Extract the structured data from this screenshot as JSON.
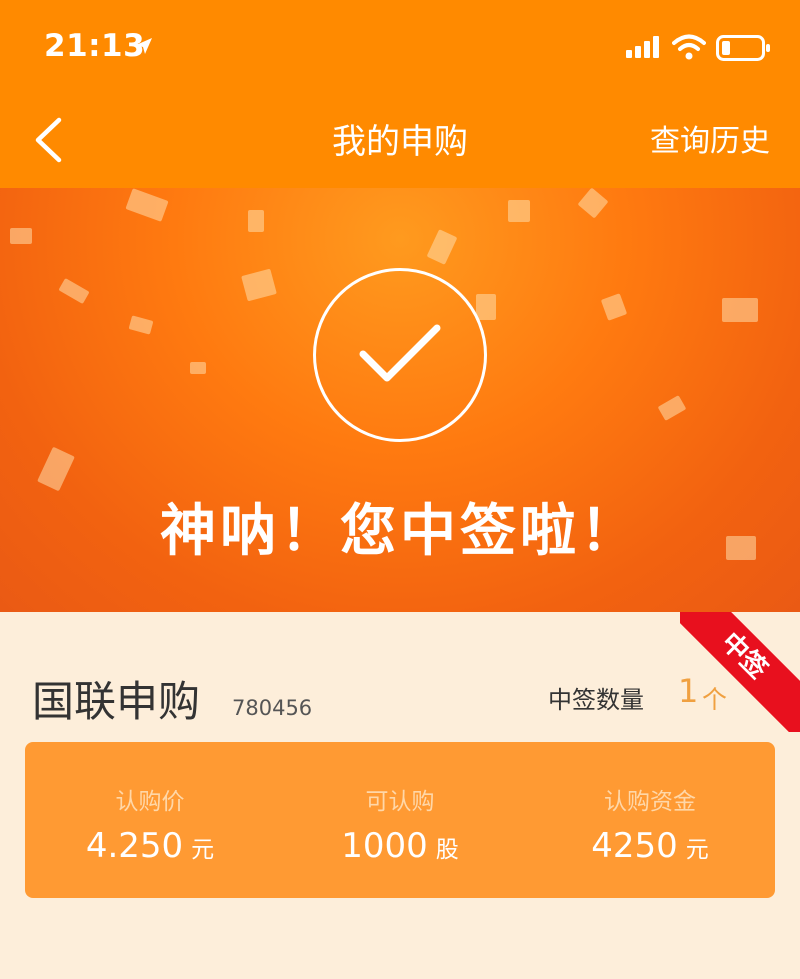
{
  "status_bar": {
    "time": "21:13"
  },
  "nav": {
    "title": "我的申购",
    "history_label": "查询历史"
  },
  "banner": {
    "headline": "神呐！您中签啦！"
  },
  "ribbon": {
    "label": "中签"
  },
  "stock": {
    "name": "国联申购",
    "code": "780456",
    "lot_label": "中签数量",
    "lot_value": "1",
    "lot_unit": "个"
  },
  "summary": [
    {
      "label": "认购价",
      "value": "4.250",
      "unit": "元"
    },
    {
      "label": "可认购",
      "value": "1000",
      "unit": "股"
    },
    {
      "label": "认购资金",
      "value": "4250",
      "unit": "元"
    }
  ],
  "colors": {
    "brand_orange": "#ff8a00",
    "card_orange": "#ff9a33",
    "page_bg": "#fdeeda",
    "ribbon_red": "#e8101e",
    "lot_accent": "#f0a040"
  },
  "icons": [
    "location-arrow-icon",
    "signal-icon",
    "wifi-icon",
    "battery-icon",
    "back-chevron-icon",
    "checkmark-icon"
  ]
}
